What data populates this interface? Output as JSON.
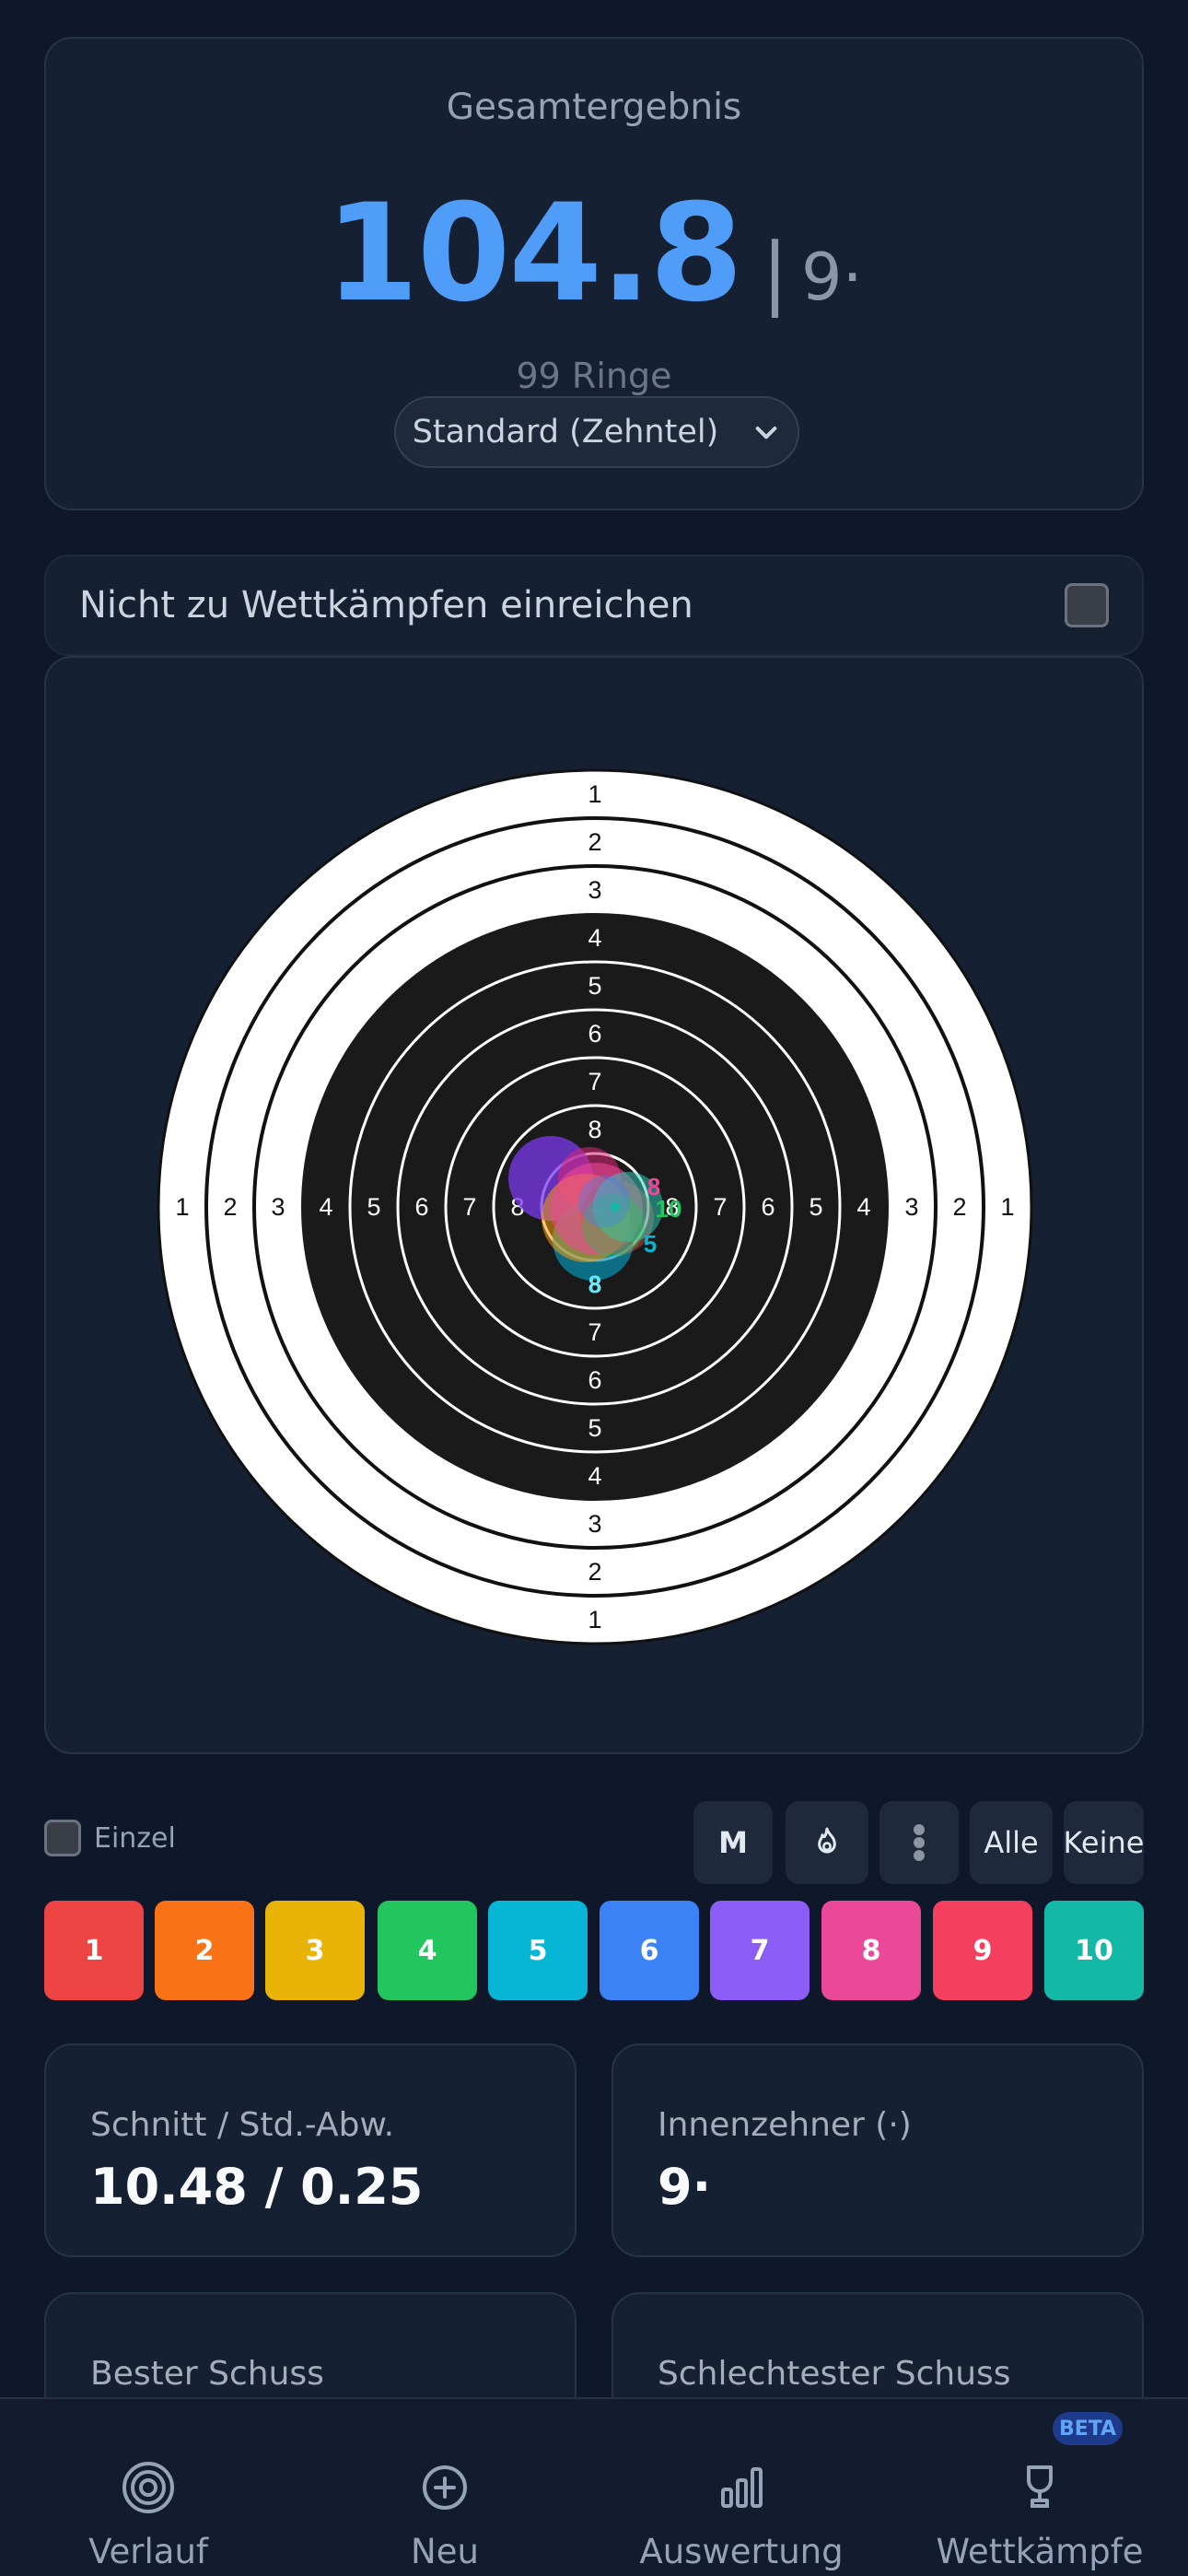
{
  "result": {
    "title": "Gesamtergebnis",
    "score": "104.8",
    "separator": "|",
    "inner_tens": "9·",
    "rings": "99 Ringe",
    "mode": "Standard (Zehntel)"
  },
  "submit": {
    "label": "Nicht zu Wettkämpfen einreichen",
    "checked": false
  },
  "target": {
    "ring_labels_vertical_top": [
      "1",
      "2",
      "3",
      "4",
      "5",
      "6",
      "7",
      "8"
    ],
    "ring_labels_vertical_bottom": [
      "8",
      "7",
      "6",
      "5",
      "4",
      "3",
      "2",
      "1"
    ],
    "ring_labels_horizontal_left": [
      "1",
      "2",
      "3",
      "4",
      "5",
      "6",
      "7",
      "8"
    ],
    "ring_labels_horizontal_right": [
      "8",
      "7",
      "6",
      "5",
      "4",
      "3",
      "2",
      "1"
    ],
    "shot_marker_labels": [
      "8",
      "10",
      "5",
      "8"
    ]
  },
  "controls": {
    "einzel_label": "Einzel",
    "m_label": "M",
    "fire_icon": "flame-icon",
    "dots_icon": "dots-vertical-icon",
    "all_label": "Alle",
    "none_label": "Keine"
  },
  "shots": [
    {
      "label": "1",
      "color": "#ef4444"
    },
    {
      "label": "2",
      "color": "#f97316"
    },
    {
      "label": "3",
      "color": "#eab308"
    },
    {
      "label": "4",
      "color": "#22c55e"
    },
    {
      "label": "5",
      "color": "#06b6d4"
    },
    {
      "label": "6",
      "color": "#3b82f6"
    },
    {
      "label": "7",
      "color": "#8b5cf6"
    },
    {
      "label": "8",
      "color": "#ec4899"
    },
    {
      "label": "9",
      "color": "#f43f5e"
    },
    {
      "label": "10",
      "color": "#14b8a6"
    }
  ],
  "stats": [
    {
      "label": "Schnitt / Std.-Abw.",
      "value": "10.48 / 0.25"
    },
    {
      "label": "Innenzehner (·)",
      "value": "9·"
    },
    {
      "label": "Bester Schuss",
      "value": ""
    },
    {
      "label": "Schlechtester Schuss",
      "value": ""
    }
  ],
  "nav": {
    "items": [
      {
        "label": "Verlauf",
        "icon": "target-icon"
      },
      {
        "label": "Neu",
        "icon": "plus-circle-icon"
      },
      {
        "label": "Auswertung",
        "icon": "bar-chart-icon"
      },
      {
        "label": "Wettkämpfe",
        "icon": "trophy-icon"
      }
    ],
    "badge": "BETA"
  },
  "colors": {
    "accent": "#4f9cf9",
    "background": "#0f172a",
    "card": "#162033"
  }
}
